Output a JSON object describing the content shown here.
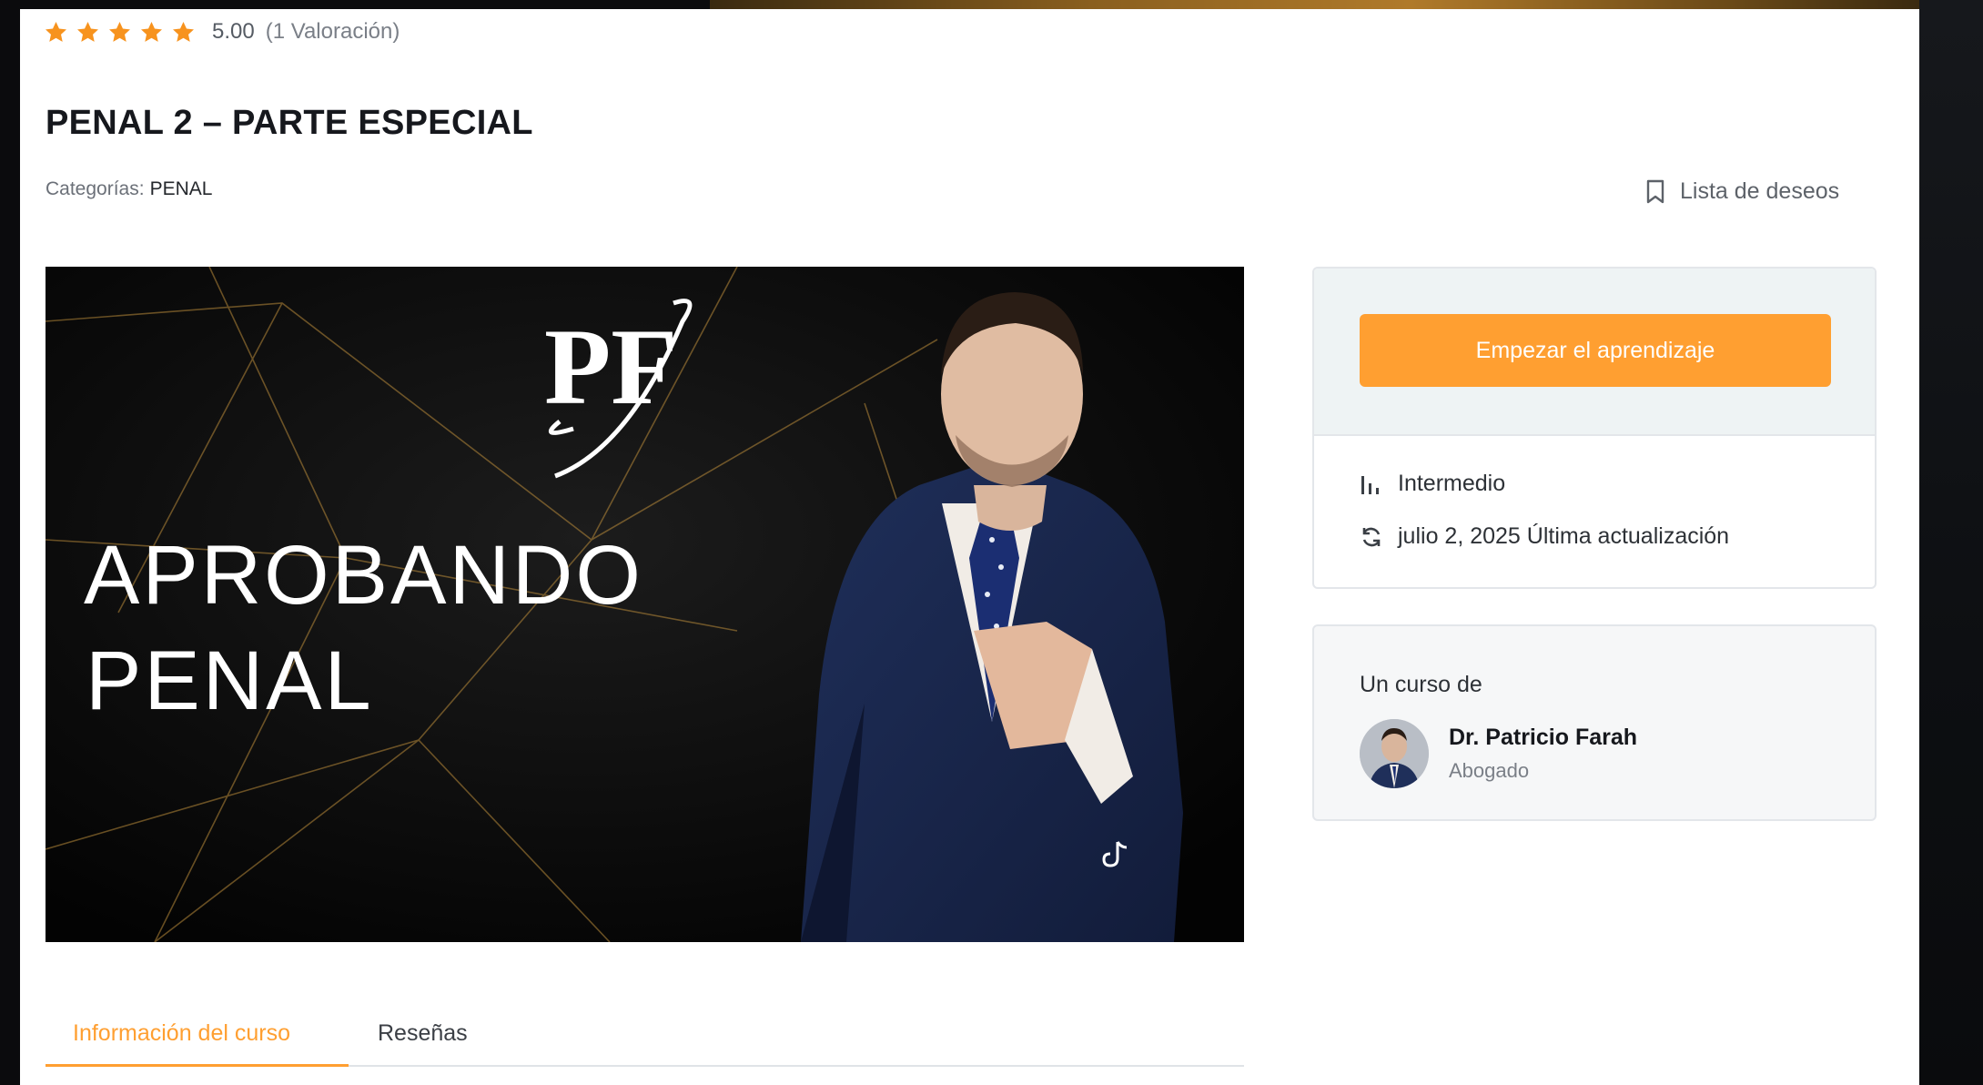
{
  "course": {
    "rating_value": "5.00",
    "rating_count": "(1 Valoración)",
    "stars": 5,
    "title": "PENAL 2 – PARTE ESPECIAL",
    "categories_label": "Categorías:",
    "category": "PENAL",
    "wishlist_label": "Lista de deseos"
  },
  "thumbnail": {
    "logo_text": "PF",
    "headline_line1": "APROBANDO",
    "headline_line2": "PENAL"
  },
  "sidebar": {
    "start_button": "Empezar el aprendizaje",
    "level": "Intermedio",
    "updated": "julio 2, 2025 Última actualización",
    "level_icon": "bar-chart-icon",
    "updated_icon": "refresh-icon"
  },
  "author": {
    "label": "Un curso de",
    "name": "Dr. Patricio Farah",
    "role": "Abogado"
  },
  "tabs": [
    {
      "label": "Información del curso",
      "active": true
    },
    {
      "label": "Reseñas",
      "active": false
    }
  ],
  "colors": {
    "accent": "#ff9f31",
    "star": "#f7931e",
    "text_dark": "#16181d",
    "panel_bg": "#eef3f4"
  }
}
